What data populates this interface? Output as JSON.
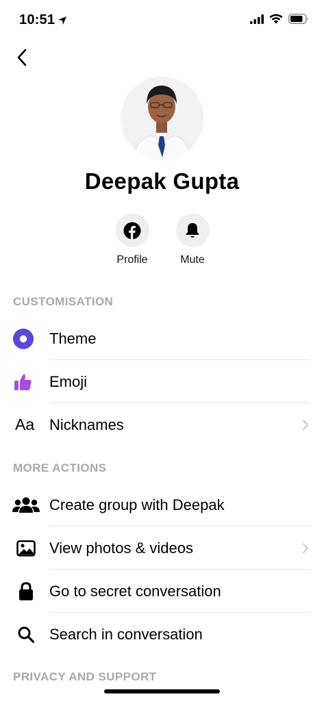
{
  "status_bar": {
    "time": "10:51"
  },
  "contact": {
    "name": "Deepak Gupta"
  },
  "quick_actions": [
    {
      "label": "Profile",
      "icon": "facebook-icon"
    },
    {
      "label": "Mute",
      "icon": "bell-icon"
    }
  ],
  "sections": {
    "customisation": {
      "header": "CUSTOMISATION",
      "items": [
        {
          "label": "Theme",
          "icon": "theme-icon"
        },
        {
          "label": "Emoji",
          "icon": "thumbs-up-icon"
        },
        {
          "label": "Nicknames",
          "icon": "aa-icon",
          "icon_text": "Aa"
        }
      ]
    },
    "more_actions": {
      "header": "MORE ACTIONS",
      "items": [
        {
          "label": "Create group with Deepak",
          "icon": "group-icon"
        },
        {
          "label": "View photos & videos",
          "icon": "image-icon"
        },
        {
          "label": "Go to secret conversation",
          "icon": "lock-icon"
        },
        {
          "label": "Search in conversation",
          "icon": "search-icon"
        }
      ]
    },
    "privacy": {
      "header": "PRIVACY AND SUPPORT"
    }
  },
  "colors": {
    "theme_accent": "#5b46e0",
    "emoji_accent": "#a44ee0",
    "section_header": "#a8a8ad"
  }
}
